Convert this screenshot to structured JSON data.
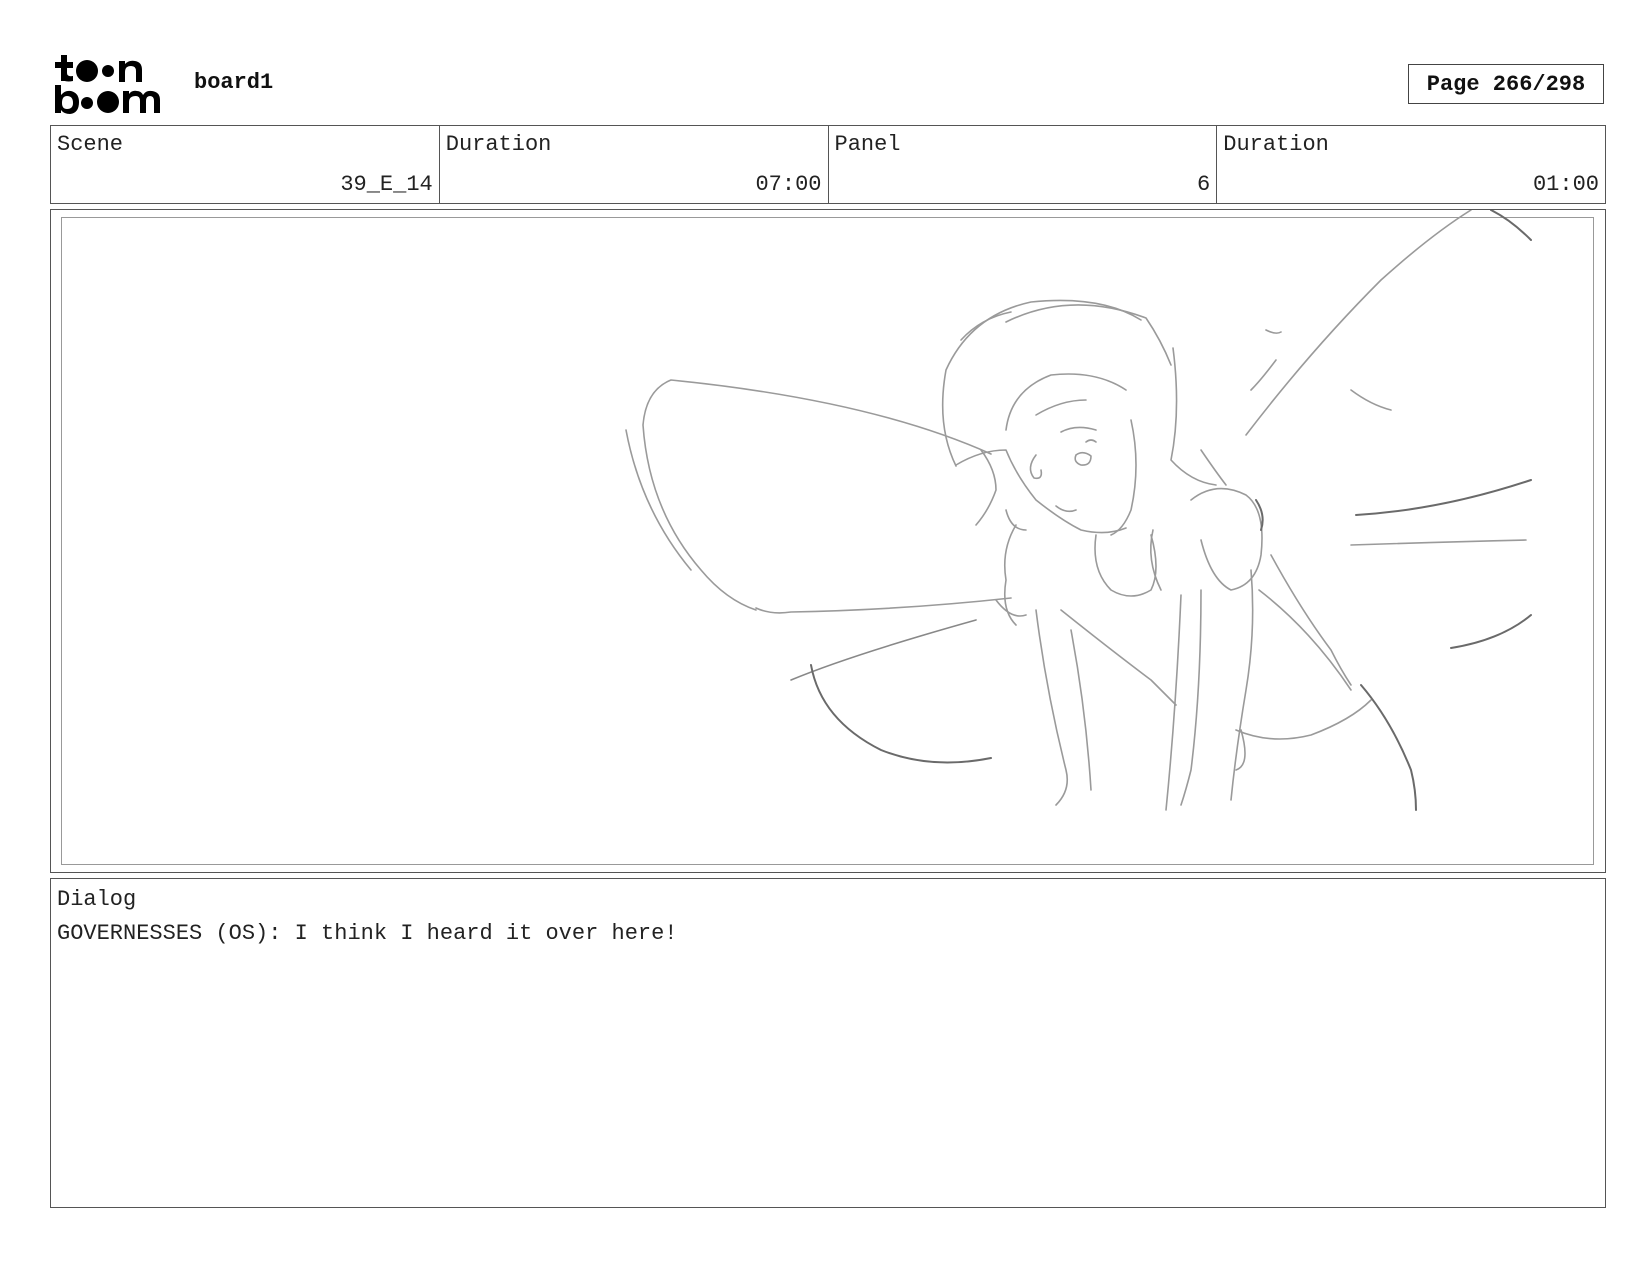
{
  "header": {
    "logo": {
      "text_top": "toon",
      "text_bottom": "boom"
    },
    "board_title": "board1",
    "page_indicator": "Page 266/298"
  },
  "info": {
    "scene": {
      "label": "Scene",
      "value": "39_E_14"
    },
    "scene_duration": {
      "label": "Duration",
      "value": "07:00"
    },
    "panel": {
      "label": "Panel",
      "value": "6"
    },
    "panel_duration": {
      "label": "Duration",
      "value": "01:00"
    }
  },
  "panel_image": {
    "subject": "fairy-sketch"
  },
  "dialog": {
    "label": "Dialog",
    "text": "GOVERNESSES (OS): I think I heard it over here!"
  }
}
